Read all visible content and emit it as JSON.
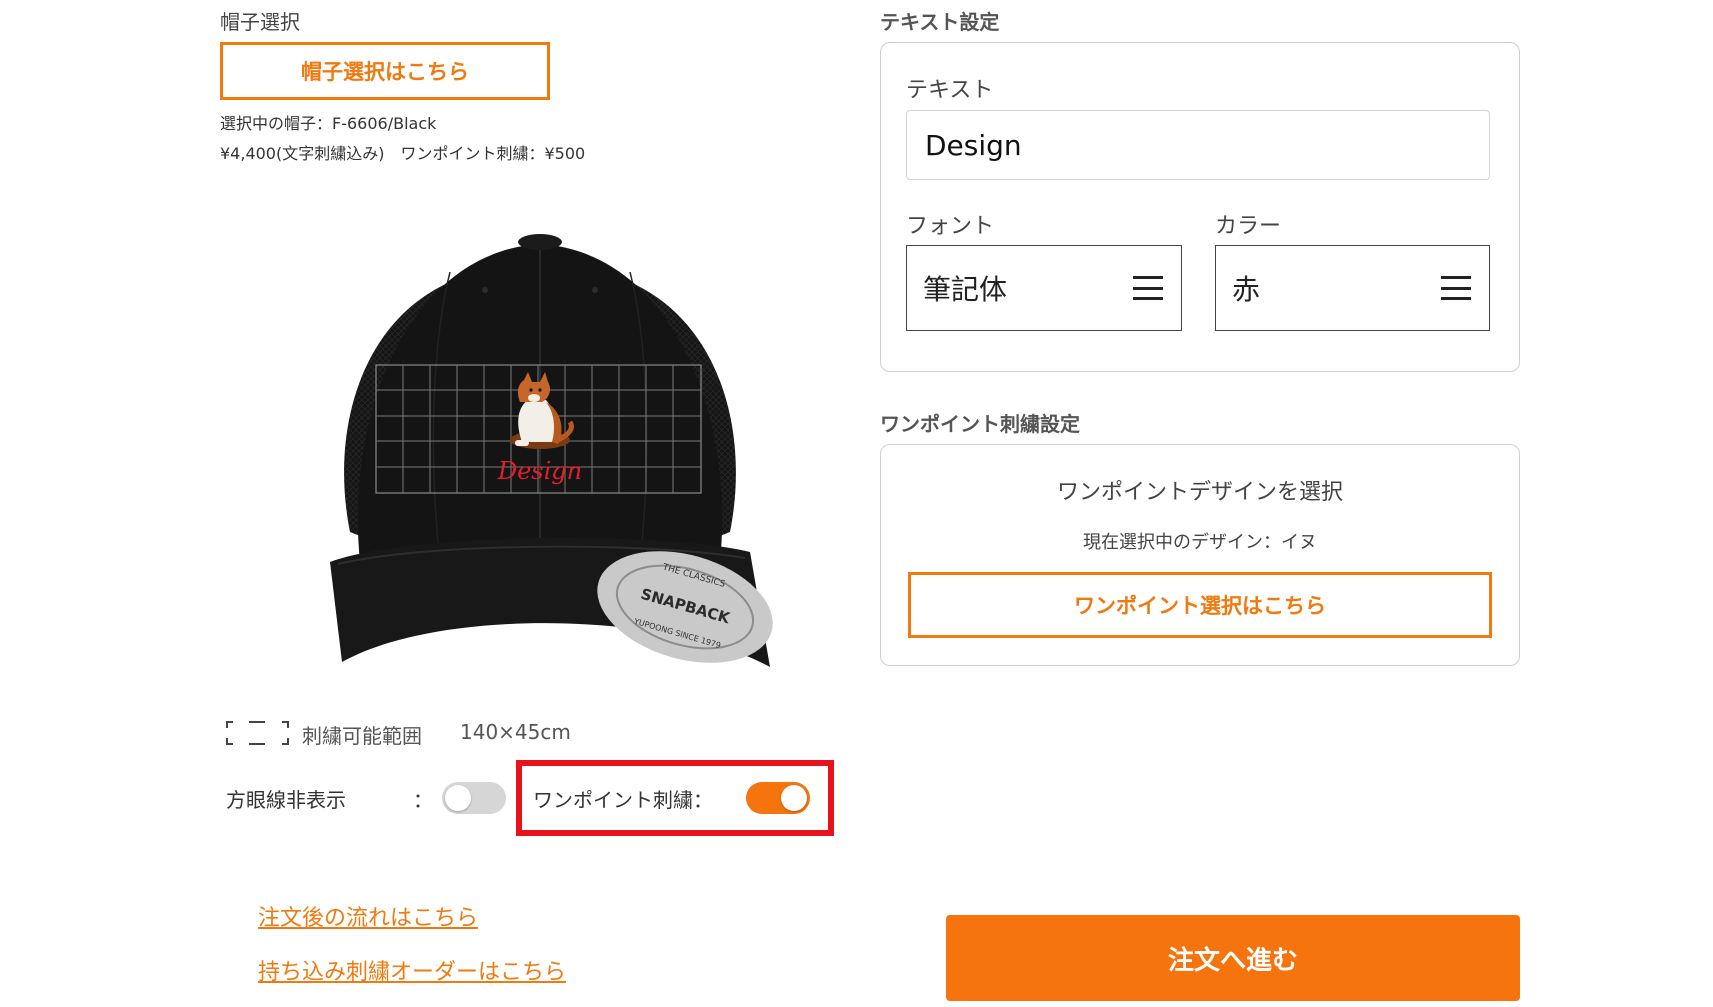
{
  "left": {
    "hat_section_label": "帽子選択",
    "hat_select_button": "帽子選択はこちら",
    "selected_hat": "選択中の帽子：F-6606/Black",
    "price_info": "¥4,400(文字刺繍込み)　ワンポイント刺繍：¥500",
    "preview": {
      "embroidery_text": "Design",
      "brim_badge_top": "THE CLASSICS",
      "brim_badge_main": "SNAPBACK",
      "brim_badge_bottom": "YUPOONG SINCE 1979"
    },
    "range_label": "刺繍可能範囲",
    "range_size": "140×45cm",
    "grid_toggle_label": "方眼線非表示",
    "grid_toggle_colon": "：",
    "grid_toggle_on": false,
    "onepoint_toggle_label": "ワンポイント刺繍：",
    "onepoint_toggle_on": true,
    "links": [
      "注文後の流れはこちら",
      "持ち込み刺繍オーダーはこちら"
    ]
  },
  "right": {
    "text_settings_title": "テキスト設定",
    "text_label": "テキスト",
    "text_value": "Design",
    "font_label": "フォント",
    "font_value": "筆記体",
    "color_label": "カラー",
    "color_value": "赤",
    "onepoint_settings_title": "ワンポイント刺繍設定",
    "onepoint_heading": "ワンポイントデザインを選択",
    "onepoint_current": "現在選択中のデザイン：イヌ",
    "onepoint_select_button": "ワンポイント選択はこちら",
    "order_button": "注文へ進む"
  },
  "colors": {
    "accent": "#f5740d",
    "highlight_border": "#e8121b",
    "embroidery_text": "#e0202a"
  }
}
